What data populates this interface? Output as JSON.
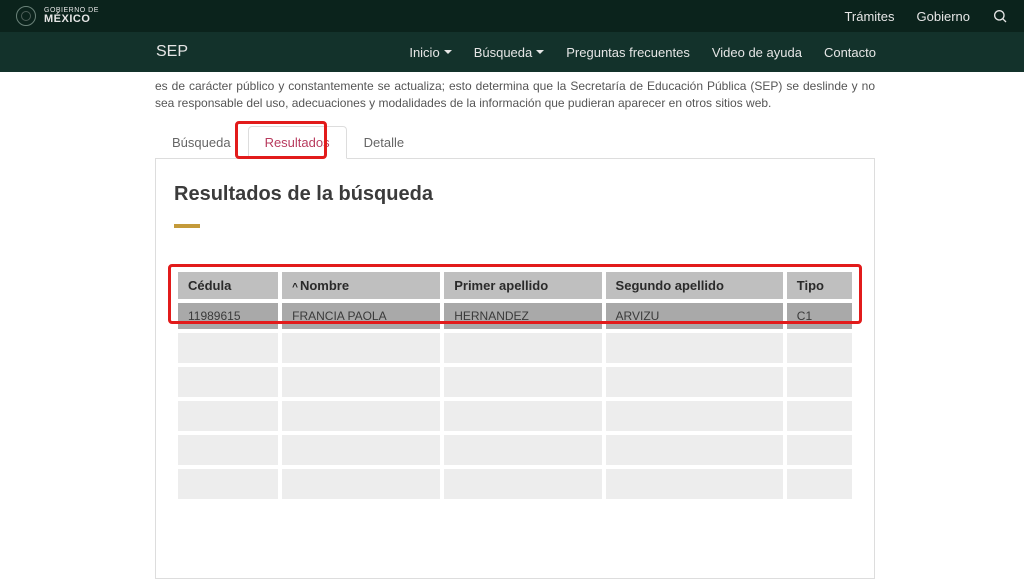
{
  "topbar": {
    "gobLine1": "GOBIERNO DE",
    "gobLine2": "MÉXICO",
    "links": {
      "tramites": "Trámites",
      "gobierno": "Gobierno"
    }
  },
  "navbar": {
    "brand": "SEP",
    "items": {
      "inicio": "Inicio",
      "busqueda": "Búsqueda",
      "preguntas": "Preguntas frecuentes",
      "video": "Video de ayuda",
      "contacto": "Contacto"
    }
  },
  "intro": "es de carácter público y constantemente se actualiza; esto determina que la Secretaría de Educación Pública (SEP) se deslinde y no sea responsable del uso, adecuaciones y modalidades de la información que pudieran aparecer en otros sitios web.",
  "tabs": {
    "busqueda": "Búsqueda",
    "resultados": "Resultados",
    "detalle": "Detalle"
  },
  "panel": {
    "title": "Resultados de la búsqueda"
  },
  "table": {
    "headers": {
      "cedula": "Cédula",
      "nombre": "Nombre",
      "primerApellido": "Primer apellido",
      "segundoApellido": "Segundo apellido",
      "tipo": "Tipo"
    },
    "rows": [
      {
        "cedula": "11989615",
        "nombre": "FRANCIA PAOLA",
        "primerApellido": "HERNANDEZ",
        "segundoApellido": "ARVIZU",
        "tipo": "C1"
      }
    ],
    "sortIndicator": "^"
  }
}
